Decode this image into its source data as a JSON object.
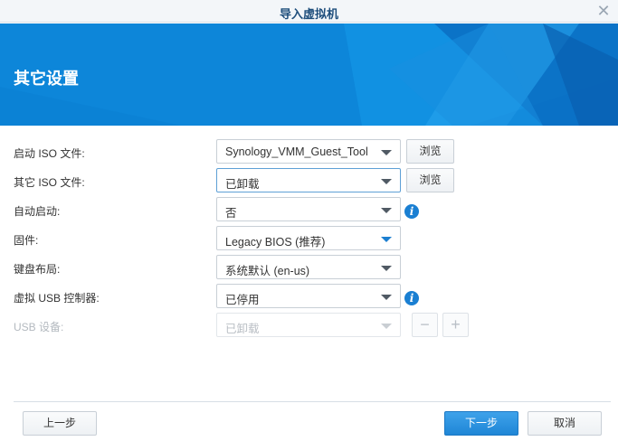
{
  "window": {
    "title": "导入虚拟机",
    "close_icon": "close-icon"
  },
  "banner": {
    "heading": "其它设置"
  },
  "fields": {
    "boot_iso": {
      "label": "启动 ISO 文件:",
      "value": "Synology_VMM_Guest_Tool",
      "browse_label": "浏览"
    },
    "other_iso": {
      "label": "其它 ISO 文件:",
      "value": "已卸载",
      "browse_label": "浏览"
    },
    "autostart": {
      "label": "自动启动:",
      "value": "否"
    },
    "firmware": {
      "label": "固件:",
      "value": "Legacy BIOS (推荐)"
    },
    "keyboard": {
      "label": "键盘布局:",
      "value": "系统默认 (en-us)"
    },
    "usb_controller": {
      "label": "虚拟 USB 控制器:",
      "value": "已停用"
    },
    "usb_device": {
      "label": "USB 设备:",
      "value": "已卸载",
      "remove_symbol": "−",
      "add_symbol": "+"
    }
  },
  "footer": {
    "prev_label": "上一步",
    "next_label": "下一步",
    "cancel_label": "取消"
  },
  "colors": {
    "accent": "#1f86d6",
    "banner": "#0d86d9",
    "title_text": "#1e4e7c"
  }
}
